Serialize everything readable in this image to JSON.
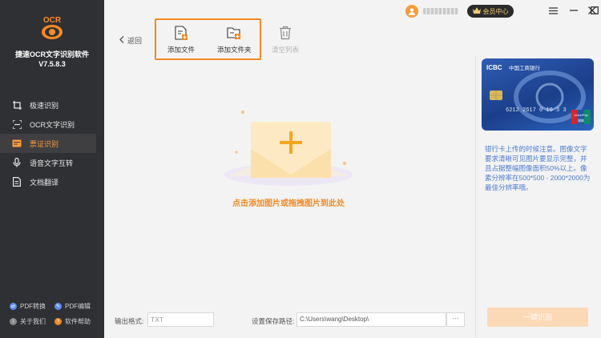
{
  "app": {
    "name": "捷速OCR文字识别软件",
    "version": "V7.5.8.3",
    "logo_text": "OCR"
  },
  "nav": [
    {
      "label": "极速识别",
      "icon": "crop-icon",
      "active": false
    },
    {
      "label": "OCR文字识别",
      "icon": "scan-frame-icon",
      "active": false
    },
    {
      "label": "票证识别",
      "icon": "ticket-icon",
      "active": true
    },
    {
      "label": "语音文字互转",
      "icon": "microphone-icon",
      "active": false
    },
    {
      "label": "文档翻译",
      "icon": "document-translate-icon",
      "active": false
    }
  ],
  "tools": [
    {
      "label": "PDF转换",
      "icon": "pdf-convert-icon",
      "color": "#5b8def"
    },
    {
      "label": "PDF编辑",
      "icon": "pdf-edit-icon",
      "color": "#5b8def"
    },
    {
      "label": "关于我们",
      "icon": "about-icon",
      "color": "#8a8a8a"
    },
    {
      "label": "软件帮助",
      "icon": "help-icon",
      "color": "#f08a24"
    }
  ],
  "topbar": {
    "vip_label": "会员中心"
  },
  "toolbar": {
    "back_label": "返回",
    "add_file_label": "添加文件",
    "add_folder_label": "添加文件夹",
    "clear_list_label": "清空列表"
  },
  "drop_area": {
    "prompt": "点击添加图片或拖拽图片到此处"
  },
  "bottom": {
    "output_format_label": "输出格式:",
    "output_format_value": "TXT",
    "save_path_label": "设置保存路径:",
    "save_path_value": "C:\\Users\\wang\\Desktop\\",
    "browse_label": "···"
  },
  "right_panel": {
    "card_bank_name": "中国工商银行",
    "card_icbc": "ICBC",
    "card_unionpay": "UnionPay",
    "card_unionpay_cn": "银联",
    "hint": "银行卡上传的时候注意。图像文字要求清晰可见图片要显示完整，并且占据整幅图像面积50%以上。像素分辨率在500*500 - 2000*2000为最佳分辨率哦。",
    "recognize_label": "一键识别"
  },
  "colors": {
    "accent": "#f08a24",
    "sidebar_bg": "#2f3033",
    "hint_text": "#4d7bd3"
  }
}
